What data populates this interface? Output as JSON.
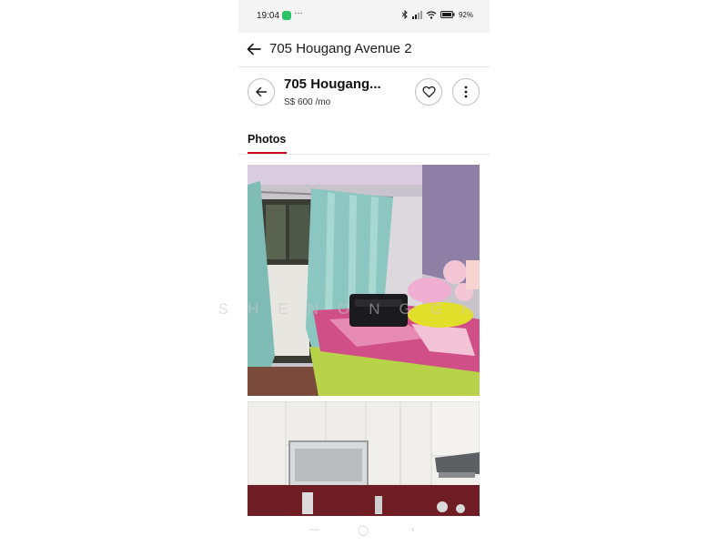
{
  "status_bar": {
    "time": "19:04",
    "notification_dots": "···",
    "battery": "92%"
  },
  "header": {
    "title": "705 Hougang Avenue 2"
  },
  "listing": {
    "title": "705 Hougang...",
    "price": "S$ 600 /mo"
  },
  "tabs": {
    "active": "Photos"
  },
  "watermark": "SHENONGGH",
  "photos": [
    {
      "subject": "bedroom with curtains and bed"
    },
    {
      "subject": "kitchen with cabinets"
    }
  ],
  "colors": {
    "accent": "#d0021b",
    "app_badge": "#2bc267"
  },
  "icons": {
    "header_back": "arrow-left-icon",
    "listing_back": "arrow-left-icon",
    "favorite": "heart-icon",
    "more": "more-vertical-icon"
  }
}
